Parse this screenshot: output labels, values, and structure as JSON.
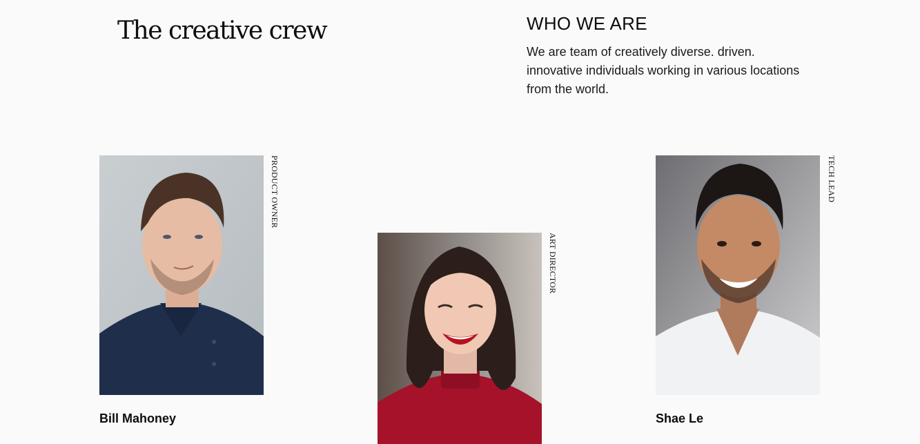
{
  "hero": {
    "title": "The creative crew"
  },
  "about": {
    "heading": "WHO WE ARE",
    "text": "We are team of creatively diverse. driven. innovative individuals working in various locations from the world."
  },
  "team": [
    {
      "name": "Bill Mahoney",
      "role": "PRODUCT OWNER"
    },
    {
      "name": "",
      "role": "ART DIRECTOR"
    },
    {
      "name": "Shae Le",
      "role": "TECH LEAD"
    }
  ],
  "colors": {
    "background": "#fafafa",
    "text": "#0d0d0d"
  }
}
